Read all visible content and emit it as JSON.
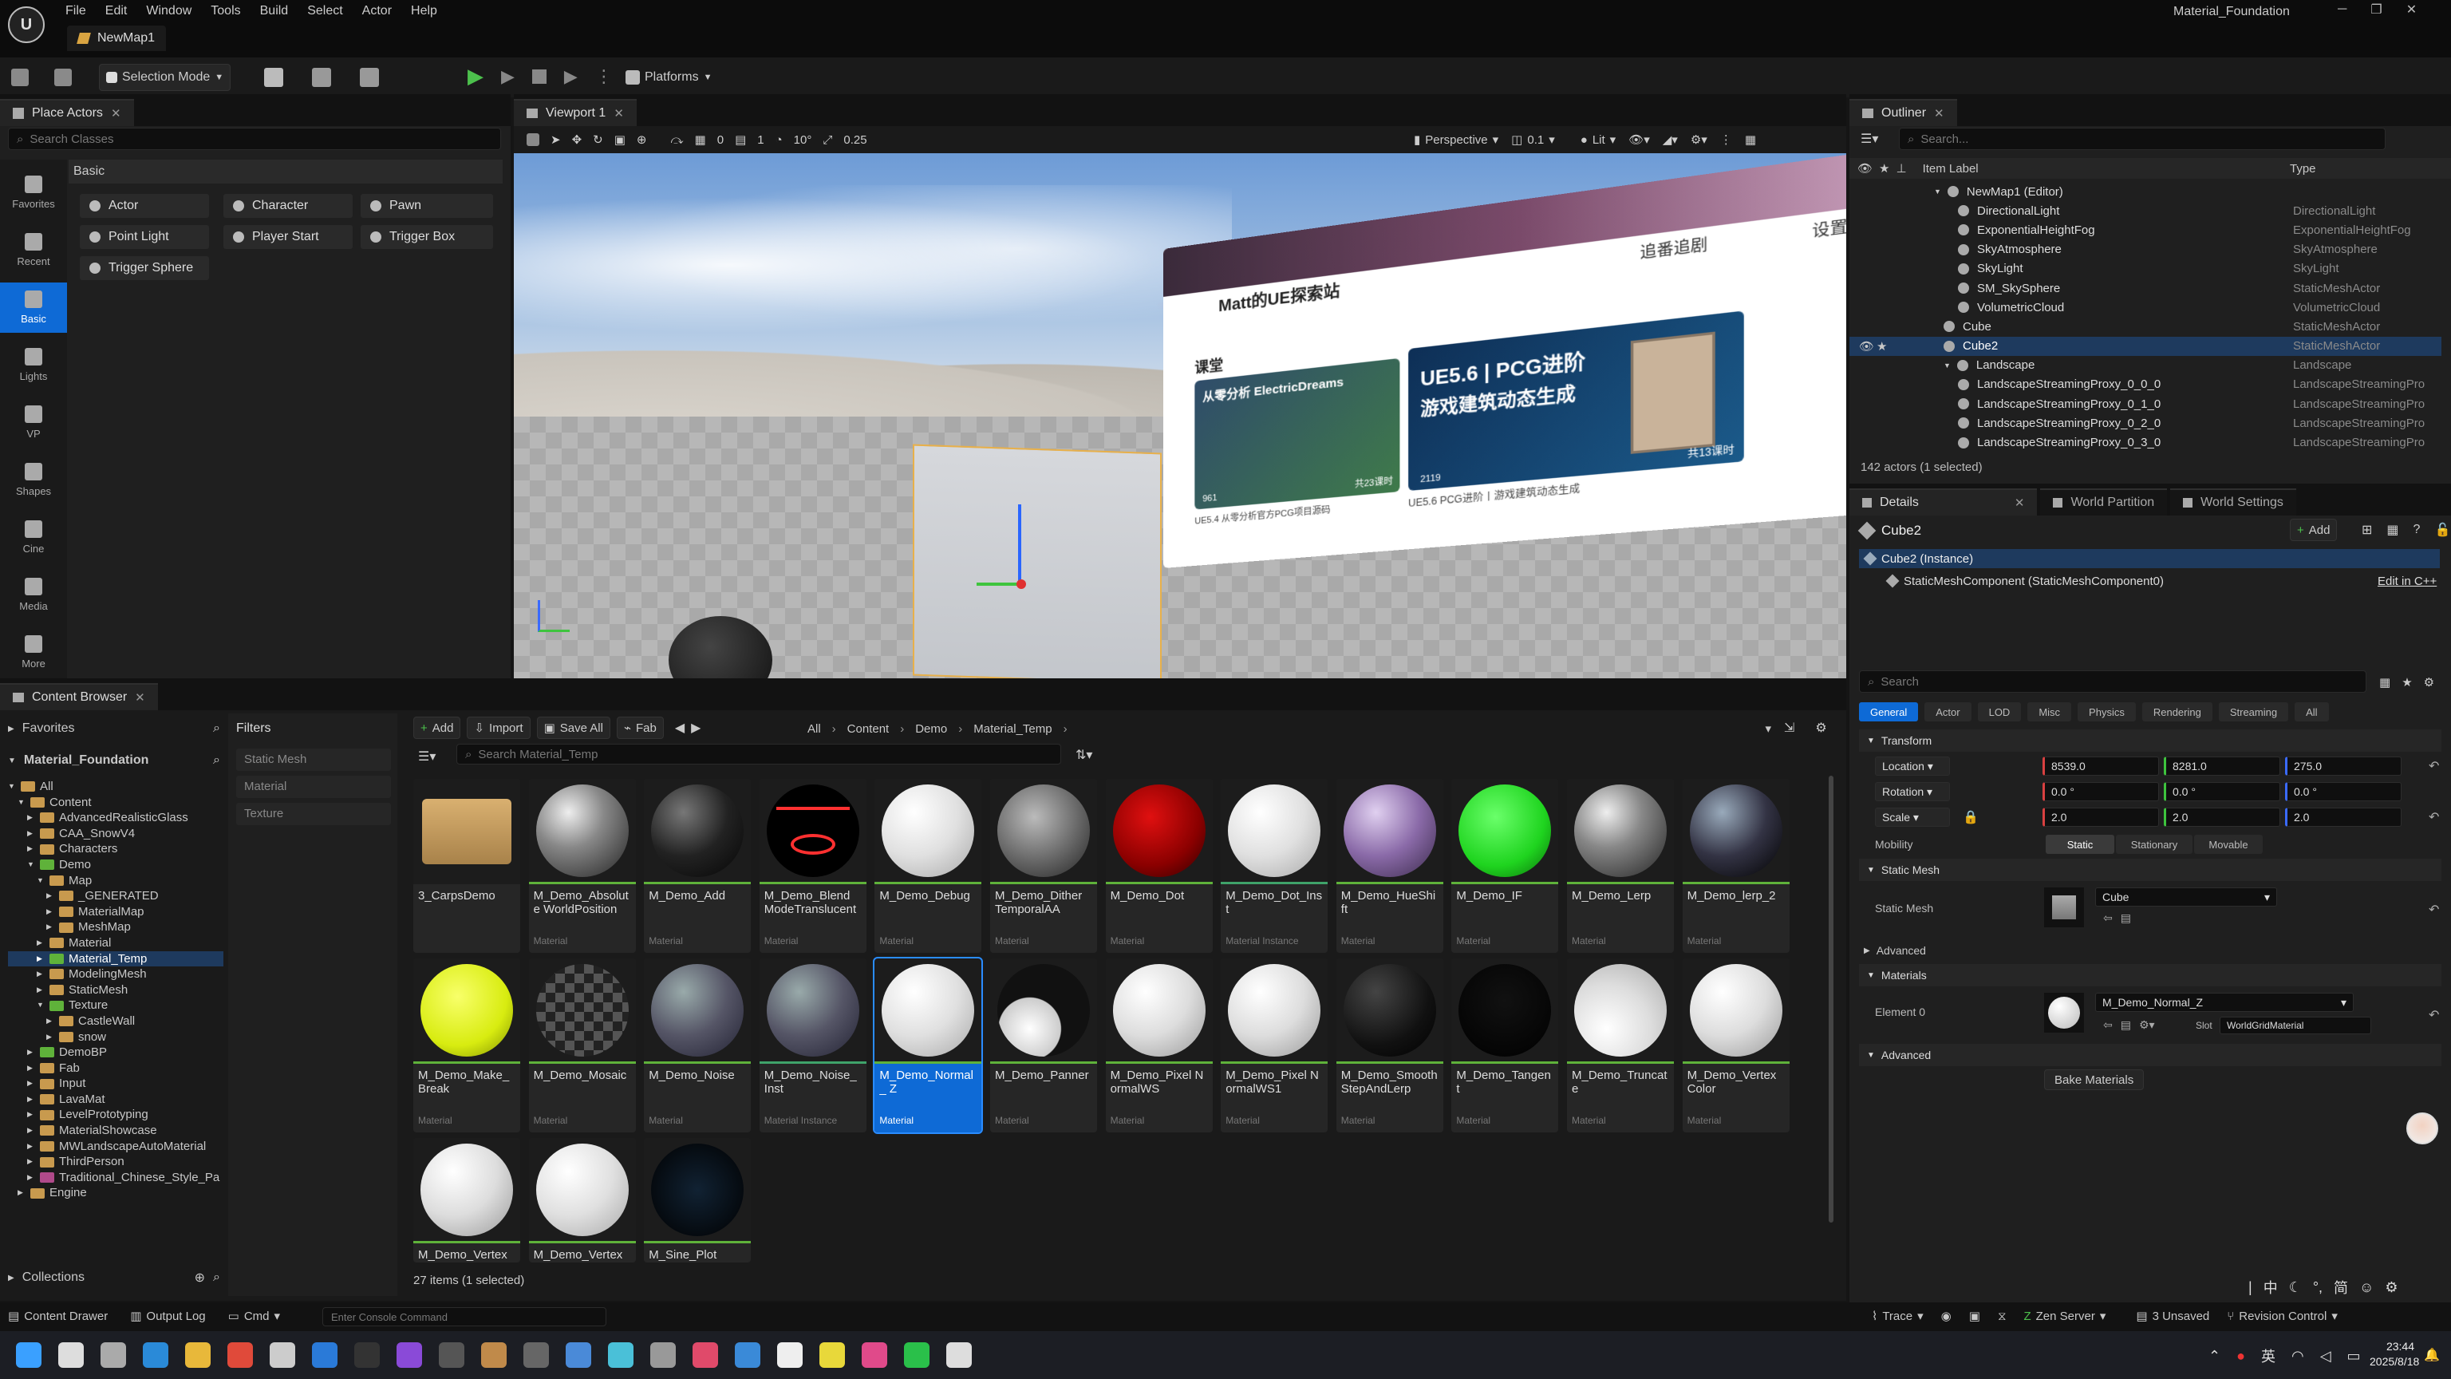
{
  "app": {
    "project_title": "Material_Foundation",
    "map_tab": "NewMap1"
  },
  "menu": [
    "File",
    "Edit",
    "Window",
    "Tools",
    "Build",
    "Select",
    "Actor",
    "Help"
  ],
  "toolbar": {
    "selection_mode": "Selection Mode",
    "platforms": "Platforms"
  },
  "place_actors": {
    "tab": "Place Actors",
    "search_placeholder": "Search Classes",
    "category": "Basic",
    "sidebar": [
      "Favorites",
      "Recent",
      "Basic",
      "Lights",
      "VP",
      "Shapes",
      "Cine",
      "Media",
      "More"
    ],
    "items": [
      "Actor",
      "Character",
      "Pawn",
      "Point Light",
      "Player Start",
      "Trigger Box",
      "Trigger Sphere"
    ]
  },
  "viewport": {
    "tab": "Viewport 1",
    "snap_angle": "10°",
    "snap_scale": "0.25",
    "grid_count": "0",
    "grid_size": "1",
    "view_mode_perspective": "Perspective",
    "view_speed": "0.1",
    "lit": "Lit",
    "billboard": {
      "user": "Matt的UE探索站",
      "search": "追番追剧",
      "settings": "设置",
      "section": "课堂",
      "card1_title": "从零分析 ElectricDreams",
      "card1_sub": "UE5.4 从零分析官方PCG项目源码",
      "card1_views": "961",
      "card1_lessons": "共23课时",
      "card2_title": "UE5.6 | PCG进阶",
      "card2_subtitle": "游戏建筑动态生成",
      "card2_views": "2119",
      "card2_lessons": "共13课时",
      "card2_caption": "UE5.6 PCG进阶丨游戏建筑动态生成"
    }
  },
  "outliner": {
    "tab": "Outliner",
    "search_placeholder": "Search...",
    "col_label": "Item Label",
    "col_type": "Type",
    "rows": [
      {
        "label": "NewMap1 (Editor)",
        "type": ""
      },
      {
        "label": "DirectionalLight",
        "type": "DirectionalLight"
      },
      {
        "label": "ExponentialHeightFog",
        "type": "ExponentialHeightFog"
      },
      {
        "label": "SkyAtmosphere",
        "type": "SkyAtmosphere"
      },
      {
        "label": "SkyLight",
        "type": "SkyLight"
      },
      {
        "label": "SM_SkySphere",
        "type": "StaticMeshActor"
      },
      {
        "label": "VolumetricCloud",
        "type": "VolumetricCloud"
      },
      {
        "label": "Cube",
        "type": "StaticMeshActor"
      },
      {
        "label": "Cube2",
        "type": "StaticMeshActor"
      },
      {
        "label": "Landscape",
        "type": "Landscape"
      },
      {
        "label": "LandscapeStreamingProxy_0_0_0",
        "type": "LandscapeStreamingPro"
      },
      {
        "label": "LandscapeStreamingProxy_0_1_0",
        "type": "LandscapeStreamingPro"
      },
      {
        "label": "LandscapeStreamingProxy_0_2_0",
        "type": "LandscapeStreamingPro"
      },
      {
        "label": "LandscapeStreamingProxy_0_3_0",
        "type": "LandscapeStreamingPro"
      }
    ],
    "status": "142 actors (1 selected)"
  },
  "details": {
    "tabs": [
      "Details",
      "World Partition",
      "World Settings"
    ],
    "actor": "Cube2",
    "add": "Add",
    "instance": "Cube2 (Instance)",
    "component": "StaticMeshComponent (StaticMeshComponent0)",
    "edit_cpp": "Edit in C++",
    "search_placeholder": "Search",
    "categories": [
      "General",
      "Actor",
      "LOD",
      "Misc",
      "Physics",
      "Rendering",
      "Streaming",
      "All"
    ],
    "transform": "Transform",
    "location_label": "Location",
    "rotation_label": "Rotation",
    "scale_label": "Scale",
    "location": [
      "8539.0",
      "8281.0",
      "275.0"
    ],
    "rotation": [
      "0.0 °",
      "0.0 °",
      "0.0 °"
    ],
    "scale": [
      "2.0",
      "2.0",
      "2.0"
    ],
    "mobility": "Mobility",
    "mobility_opts": [
      "Static",
      "Stationary",
      "Movable"
    ],
    "static_mesh_section": "Static Mesh",
    "static_mesh_label": "Static Mesh",
    "static_mesh_value": "Cube",
    "advanced": "Advanced",
    "materials": "Materials",
    "element0": "Element 0",
    "material_value": "M_Demo_Normal_Z",
    "slot_label": "Slot",
    "slot_value": "WorldGridMaterial",
    "advanced2": "Advanced",
    "bake": "Bake Materials"
  },
  "content_browser": {
    "tab": "Content Browser",
    "favorites": "Favorites",
    "root": "Material_Foundation",
    "filters": "Filters",
    "filter_items": [
      "Static Mesh",
      "Material",
      "Texture"
    ],
    "buttons": {
      "add": "Add",
      "import": "Import",
      "save_all": "Save All",
      "fab": "Fab"
    },
    "breadcrumb": [
      "All",
      "Content",
      "Demo",
      "Material_Temp"
    ],
    "search_placeholder": "Search Material_Temp",
    "tree": [
      {
        "label": "All",
        "depth": 0,
        "c": "y"
      },
      {
        "label": "Content",
        "depth": 1,
        "c": "y"
      },
      {
        "label": "AdvancedRealisticGlass",
        "depth": 2,
        "c": "y"
      },
      {
        "label": "CAA_SnowV4",
        "depth": 2,
        "c": "y"
      },
      {
        "label": "Characters",
        "depth": 2,
        "c": "y"
      },
      {
        "label": "Demo",
        "depth": 2,
        "c": "g"
      },
      {
        "label": "Map",
        "depth": 3,
        "c": "y"
      },
      {
        "label": "_GENERATED",
        "depth": 4,
        "c": "y"
      },
      {
        "label": "MaterialMap",
        "depth": 4,
        "c": "y"
      },
      {
        "label": "MeshMap",
        "depth": 4,
        "c": "y"
      },
      {
        "label": "Material",
        "depth": 3,
        "c": "y"
      },
      {
        "label": "Material_Temp",
        "depth": 3,
        "c": "g",
        "sel": true
      },
      {
        "label": "ModelingMesh",
        "depth": 3,
        "c": "y"
      },
      {
        "label": "StaticMesh",
        "depth": 3,
        "c": "y"
      },
      {
        "label": "Texture",
        "depth": 3,
        "c": "g"
      },
      {
        "label": "CastleWall",
        "depth": 4,
        "c": "y"
      },
      {
        "label": "snow",
        "depth": 4,
        "c": "y"
      },
      {
        "label": "DemoBP",
        "depth": 2,
        "c": "g"
      },
      {
        "label": "Fab",
        "depth": 2,
        "c": "y"
      },
      {
        "label": "Input",
        "depth": 2,
        "c": "y"
      },
      {
        "label": "LavaMat",
        "depth": 2,
        "c": "y"
      },
      {
        "label": "LevelPrototyping",
        "depth": 2,
        "c": "y"
      },
      {
        "label": "MaterialShowcase",
        "depth": 2,
        "c": "y"
      },
      {
        "label": "MWLandscapeAutoMaterial",
        "depth": 2,
        "c": "y"
      },
      {
        "label": "ThirdPerson",
        "depth": 2,
        "c": "y"
      },
      {
        "label": "Traditional_Chinese_Style_Pa",
        "depth": 2,
        "c": "p"
      },
      {
        "label": "Engine",
        "depth": 1,
        "c": "y"
      }
    ],
    "collections": "Collections",
    "assets": [
      {
        "name": "3_CarpsDemo",
        "kind": "",
        "style": "folder"
      },
      {
        "name": "M_Demo_Absolute WorldPosition",
        "kind": "Material",
        "style": "stone"
      },
      {
        "name": "M_Demo_Add",
        "kind": "Material",
        "style": "darkstone"
      },
      {
        "name": "M_Demo_Blend ModeTranslucent",
        "kind": "Material",
        "style": "redline"
      },
      {
        "name": "M_Demo_Debug",
        "kind": "Material",
        "style": "white"
      },
      {
        "name": "M_Demo_Dither TemporalAA",
        "kind": "Material",
        "style": "graystone"
      },
      {
        "name": "M_Demo_Dot",
        "kind": "Material",
        "style": "red"
      },
      {
        "name": "M_Demo_Dot_Inst",
        "kind": "Material Instance",
        "style": "white"
      },
      {
        "name": "M_Demo_HueShift",
        "kind": "Material",
        "style": "purple"
      },
      {
        "name": "M_Demo_IF",
        "kind": "Material",
        "style": "green"
      },
      {
        "name": "M_Demo_Lerp",
        "kind": "Material",
        "style": "stone"
      },
      {
        "name": "M_Demo_lerp_2",
        "kind": "Material",
        "style": "darkblue"
      },
      {
        "name": "M_Demo_Make_ Break",
        "kind": "Material",
        "style": "yellow"
      },
      {
        "name": "M_Demo_Mosaic",
        "kind": "Material",
        "style": "checker"
      },
      {
        "name": "M_Demo_Noise",
        "kind": "Material",
        "style": "noise"
      },
      {
        "name": "M_Demo_Noise_ Inst",
        "kind": "Material Instance",
        "style": "noise"
      },
      {
        "name": "M_Demo_Normal_ Z",
        "kind": "Material",
        "style": "white",
        "sel": true
      },
      {
        "name": "M_Demo_Panner",
        "kind": "Material",
        "style": "panner"
      },
      {
        "name": "M_Demo_Pixel NormalWS",
        "kind": "Material",
        "style": "snow"
      },
      {
        "name": "M_Demo_Pixel NormalWS1",
        "kind": "Material",
        "style": "snow"
      },
      {
        "name": "M_Demo_Smooth StepAndLerp",
        "kind": "Material",
        "style": "blackline"
      },
      {
        "name": "M_Demo_Tangent",
        "kind": "Material",
        "style": "black"
      },
      {
        "name": "M_Demo_Truncate",
        "kind": "Material",
        "style": "trunc"
      },
      {
        "name": "M_Demo_Vertex Color",
        "kind": "Material",
        "style": "snow"
      },
      {
        "name": "M_Demo_Vertex",
        "kind": "",
        "style": "snow"
      },
      {
        "name": "M_Demo_Vertex",
        "kind": "",
        "style": "white"
      },
      {
        "name": "M_Sine_Plot",
        "kind": "",
        "style": "sine"
      }
    ],
    "status": "27 items (1 selected)"
  },
  "statusbar": {
    "content_drawer": "Content Drawer",
    "output_log": "Output Log",
    "cmd": "Cmd",
    "console_placeholder": "Enter Console Command",
    "trace": "Trace",
    "zen": "Zen Server",
    "unsaved": "3 Unsaved",
    "revision": "Revision Control"
  },
  "taskbar": {
    "time": "23:44",
    "date": "2025/8/18"
  }
}
